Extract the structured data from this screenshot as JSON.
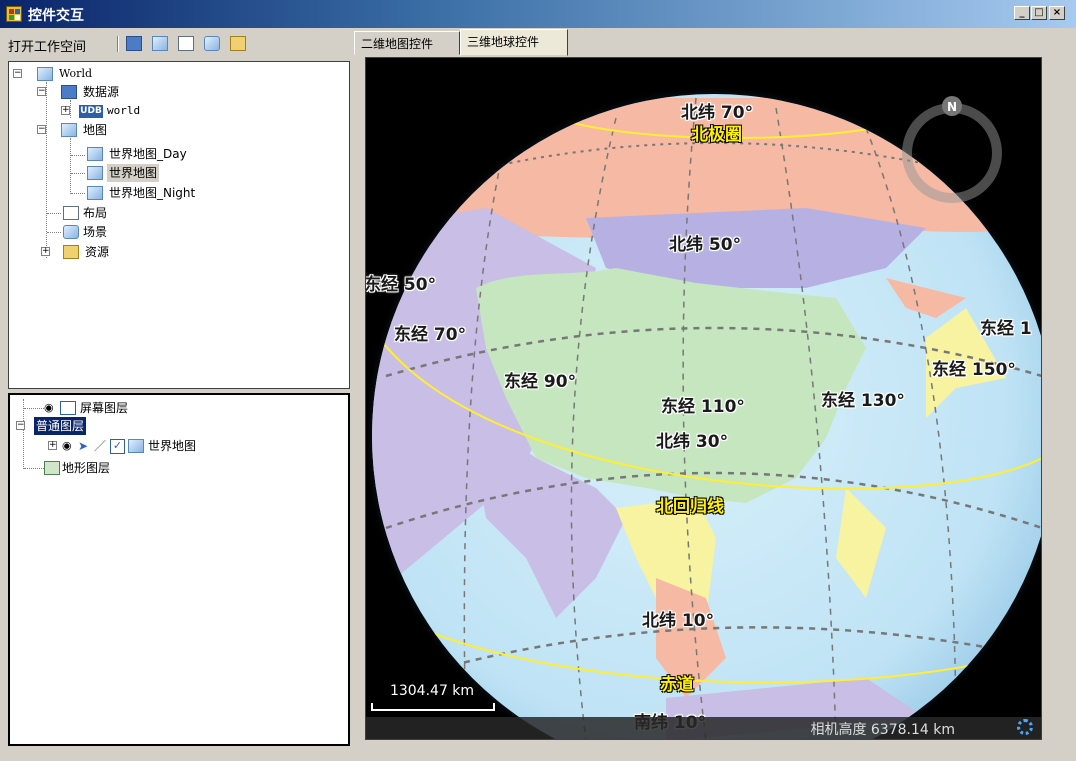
{
  "window": {
    "title": "控件交互",
    "min": "_",
    "max": "□",
    "close": "×"
  },
  "toolbar": {
    "open_workspace": "打开工作空间"
  },
  "workspace_tree": {
    "root": "World",
    "datasources": "数据源",
    "datasource_world": "world",
    "datasource_badge": "UDB",
    "maps": "地图",
    "map_day": "世界地图_Day",
    "map_world": "世界地图",
    "map_night": "世界地图_Night",
    "layouts": "布局",
    "scenes": "场景",
    "resources": "资源"
  },
  "layer_tree": {
    "screen_layers": "屏幕图层",
    "normal_layers": "普通图层",
    "layer_world": "世界地图",
    "terrain_layers": "地形图层"
  },
  "tabs": {
    "map2d": "二维地图控件",
    "globe3d": "三维地球控件"
  },
  "globe": {
    "compass": "N",
    "labels": {
      "lat70": "北纬 70°",
      "arctic": "北极圈",
      "lat50": "北纬 50°",
      "lon50": "东经 50°",
      "lon70": "东经 70°",
      "lon90": "东经 90°",
      "lon110": "东经 110°",
      "lat30": "北纬 30°",
      "lon130": "东经 130°",
      "lon150": "东经 150°",
      "lon170": "东经 1",
      "tropic": "北回归线",
      "lat10": "北纬 10°",
      "equator": "赤道",
      "lat_s10": "南纬 10°"
    },
    "scale": "1304.47 km",
    "camera_height": "相机高度 6378.14 km"
  },
  "colors": {
    "ocean": "#bfe3f5",
    "accent_yellow": "#fff000",
    "title_gradient_start": "#0a246a"
  }
}
